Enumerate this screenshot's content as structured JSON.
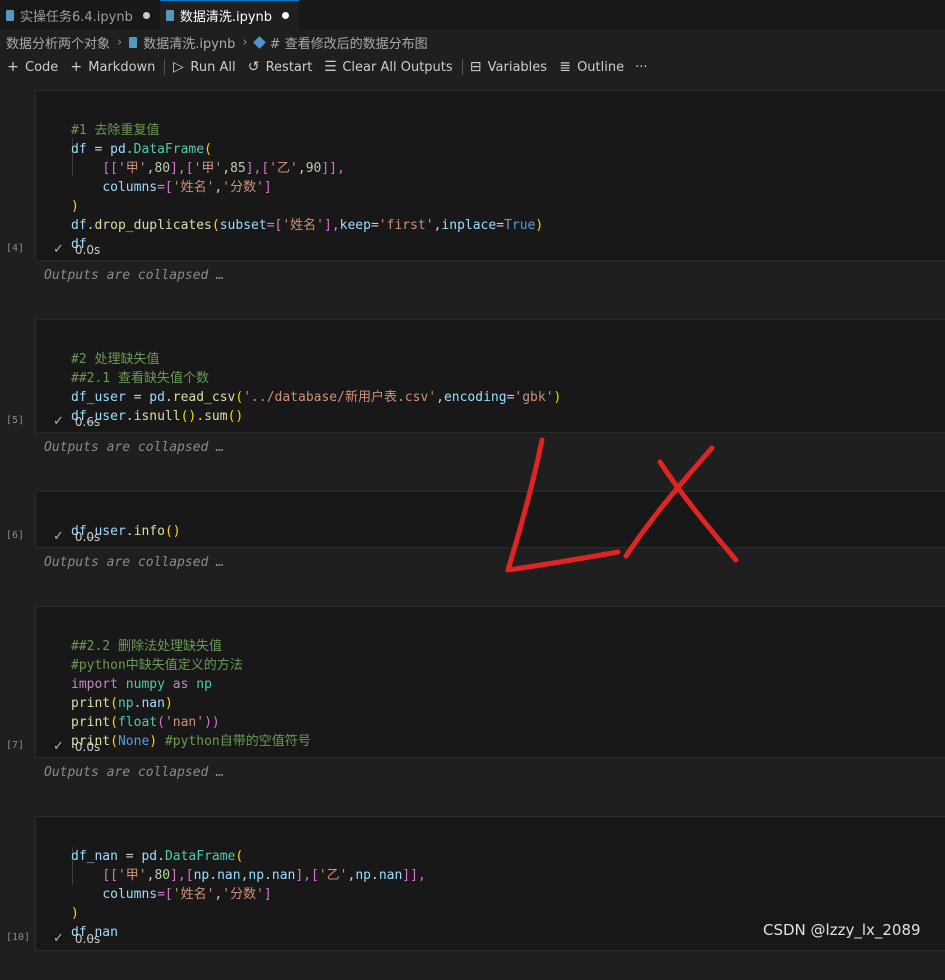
{
  "tabs": [
    {
      "label": "实操任务6.4.ipynb",
      "active": false
    },
    {
      "label": "数据清洗.ipynb",
      "active": true
    }
  ],
  "breadcrumb": [
    "数据分析两个对象",
    "数据清洗.ipynb",
    "# 查看修改后的数据分布图"
  ],
  "toolbar": {
    "code": "Code",
    "markdown": "Markdown",
    "run_all": "Run All",
    "restart": "Restart",
    "clear_all_outputs": "Clear All Outputs",
    "variables": "Variables",
    "outline": "Outline",
    "more": "···"
  },
  "cells": [
    {
      "exec": "[4]",
      "time": "0.0s",
      "collapsed": "Outputs are collapsed …"
    },
    {
      "exec": "[5]",
      "time": "0.6s",
      "collapsed": "Outputs are collapsed …"
    },
    {
      "exec": "[6]",
      "time": "0.0s",
      "collapsed": "Outputs are collapsed …"
    },
    {
      "exec": "[7]",
      "time": "0.0s",
      "collapsed": "Outputs are collapsed …"
    },
    {
      "exec": "[10]",
      "time": "0.0s"
    }
  ],
  "code": {
    "c4": {
      "l1": "#1 去除重复值",
      "l2a": "df",
      "l2b": " = ",
      "l2c": "pd",
      "l2d": ".",
      "l2e": "DataFrame",
      "l2f": "(",
      "l3a": "[[",
      "l3b": "'甲'",
      "l3c": ",",
      "l3d": "80",
      "l3e": "],[",
      "l3f": "'甲'",
      "l3g": ",",
      "l3h": "85",
      "l3i": "],[",
      "l3j": "'乙'",
      "l3k": ",",
      "l3l": "90",
      "l3m": "]],",
      "l4a": "columns",
      "l4b": "=[",
      "l4c": "'姓名'",
      "l4d": ",",
      "l4e": "'分数'",
      "l4f": "]",
      "l5": ")",
      "l6a": "df",
      "l6b": ".",
      "l6c": "drop_duplicates",
      "l6d": "(",
      "l6e": "subset",
      "l6f": "=[",
      "l6g": "'姓名'",
      "l6h": "],",
      "l6i": "keep",
      "l6j": "=",
      "l6k": "'first'",
      "l6l": ",",
      "l6m": "inplace",
      "l6n": "=",
      "l6o": "True",
      "l6p": ")",
      "l7": "df"
    },
    "c5": {
      "l1": "#2 处理缺失值",
      "l2": "##2.1 查看缺失值个数",
      "l3a": "df_user",
      "l3b": " = ",
      "l3c": "pd",
      "l3d": ".",
      "l3e": "read_csv",
      "l3f": "(",
      "l3g": "'../database/新用户表.csv'",
      "l3h": ",",
      "l3i": "encoding",
      "l3j": "=",
      "l3k": "'gbk'",
      "l3l": ")",
      "l4a": "df_user",
      "l4b": ".",
      "l4c": "isnull",
      "l4d": "().",
      "l4e": "sum",
      "l4f": "()"
    },
    "c6": {
      "l1a": "df_user",
      "l1b": ".",
      "l1c": "info",
      "l1d": "()"
    },
    "c7": {
      "l1": "##2.2 删除法处理缺失值",
      "l2": "#python中缺失值定义的方法",
      "l3a": "import",
      "l3b": " numpy ",
      "l3c": "as",
      "l3d": " np",
      "l4a": "print",
      "l4b": "(",
      "l4c": "np",
      "l4d": ".",
      "l4e": "nan",
      "l4f": ")",
      "l5a": "print",
      "l5b": "(",
      "l5c": "float",
      "l5d": "(",
      "l5e": "'nan'",
      "l5f": "))",
      "l6a": "print",
      "l6b": "(",
      "l6c": "None",
      "l6d": ") ",
      "l6e": "#python自带的空值符号"
    },
    "c10": {
      "l1a": "df_nan",
      "l1b": " = ",
      "l1c": "pd",
      "l1d": ".",
      "l1e": "DataFrame",
      "l1f": "(",
      "l2a": "[[",
      "l2b": "'甲'",
      "l2c": ",",
      "l2d": "80",
      "l2e": "],[",
      "l2f": "np",
      "l2g": ".",
      "l2h": "nan",
      "l2i": ",",
      "l2j": "np",
      "l2k": ".",
      "l2l": "nan",
      "l2m": "],[",
      "l2n": "'乙'",
      "l2o": ",",
      "l2p": "np",
      "l2q": ".",
      "l2r": "nan",
      "l2s": "]],",
      "l3a": "columns",
      "l3b": "=[",
      "l3c": "'姓名'",
      "l3d": ",",
      "l3e": "'分数'",
      "l3f": "]",
      "l4": ")",
      "l5": "df_nan"
    }
  },
  "annotation": {
    "color": "#e02424"
  },
  "watermark": "CSDN @lzzy_lx_2089",
  "colors": {
    "background": "#1f1f1f",
    "accent": "#0078d4",
    "success": "#89d185"
  }
}
